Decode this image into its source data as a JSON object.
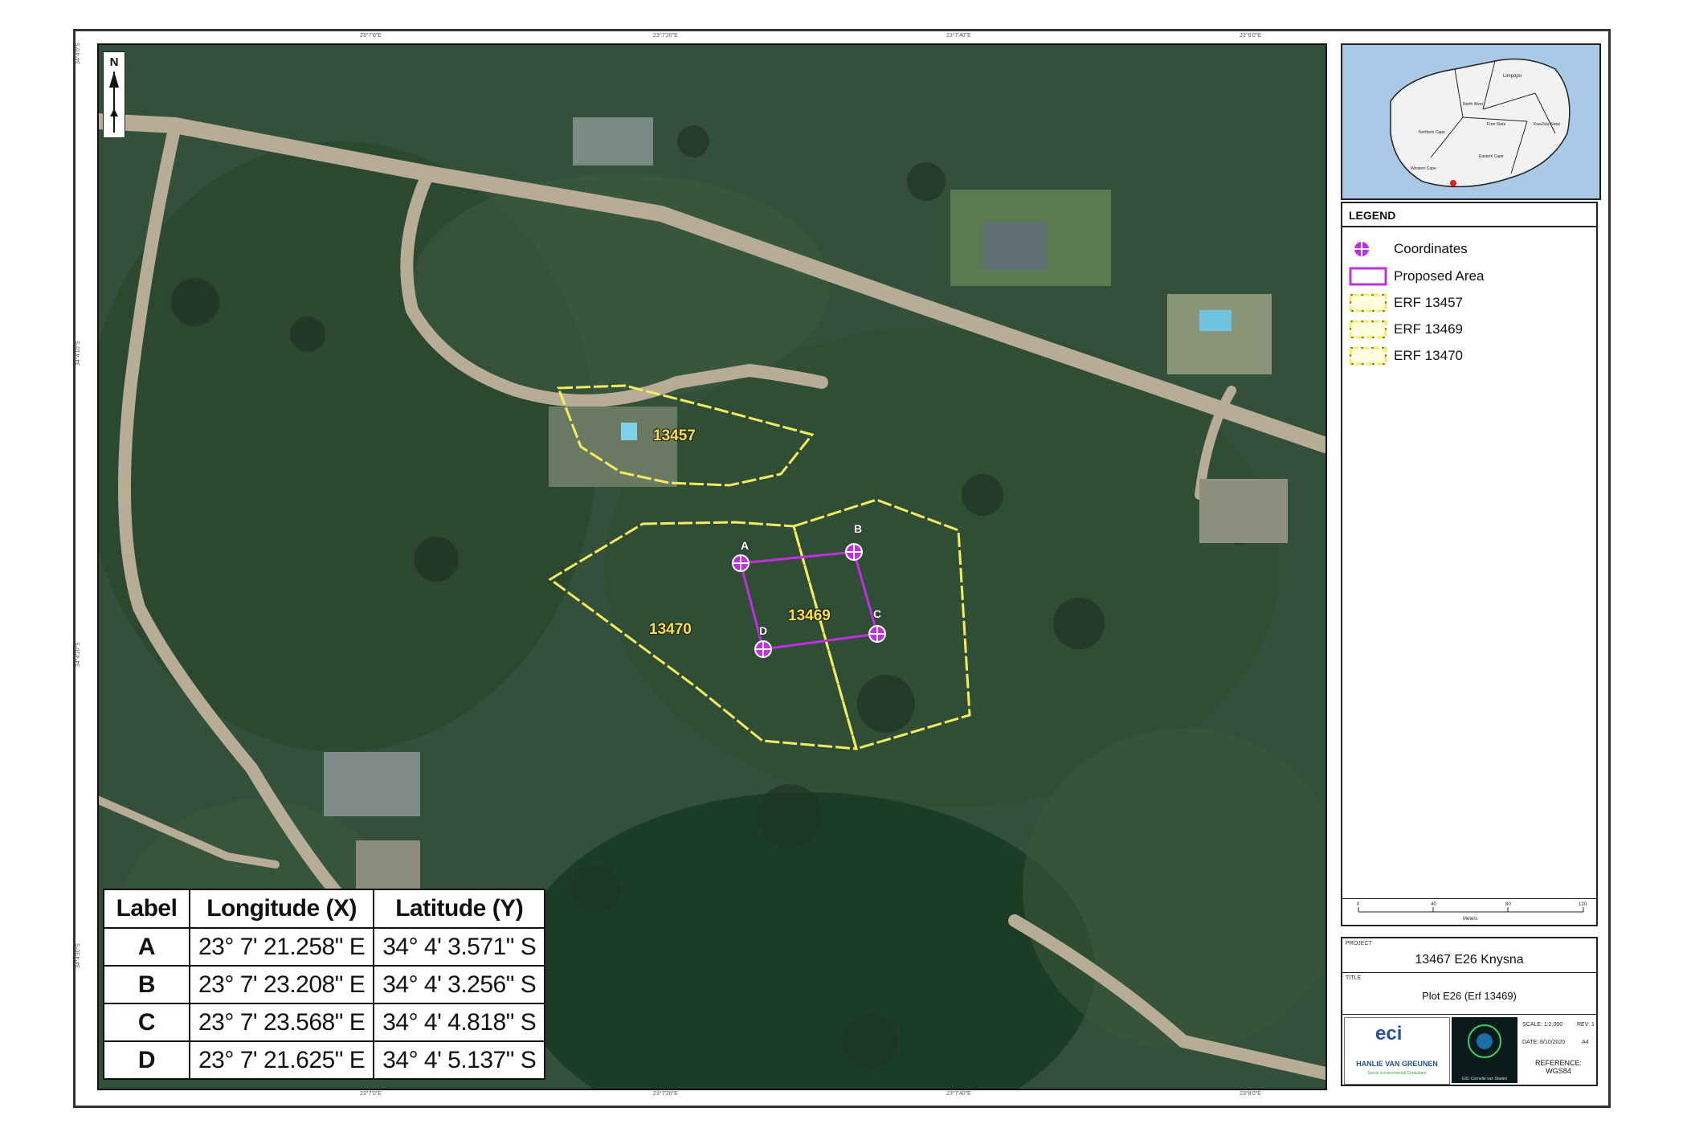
{
  "map": {
    "erf_labels": [
      "13457",
      "13469",
      "13470"
    ],
    "point_labels": [
      "A",
      "B",
      "C",
      "D"
    ],
    "north_label": "N",
    "ticks_top": [
      "23°7'0\"E",
      "23°7'20\"E",
      "23°7'40\"E",
      "23°8'0\"E"
    ],
    "ticks_bottom": [
      "23°7'0\"E",
      "23°7'20\"E",
      "23°7'40\"E",
      "23°8'0\"E"
    ],
    "ticks_left": [
      "34°4'0\"S",
      "34°4'10\"S",
      "34°4'20\"S",
      "34°4'30\"S"
    ]
  },
  "coords_table": {
    "headers": [
      "Label",
      "Longitude (X)",
      "Latitude (Y)"
    ],
    "rows": [
      {
        "label": "A",
        "lon": "23° 7' 21.258\" E",
        "lat": "34° 4' 3.571\" S"
      },
      {
        "label": "B",
        "lon": "23° 7' 23.208\" E",
        "lat": "34° 4' 3.256\" S"
      },
      {
        "label": "C",
        "lon": "23° 7' 23.568\" E",
        "lat": "34° 4' 4.818\" S"
      },
      {
        "label": "D",
        "lon": "23° 7' 21.625\" E",
        "lat": "34° 4' 5.137\" S"
      }
    ]
  },
  "inset": {
    "regions": [
      "Limpopo",
      "North West",
      "Free State",
      "Northern Cape",
      "Western Cape",
      "Eastern Cape",
      "KwaZulu-Natal"
    ],
    "marker_color": "#e0201c"
  },
  "legend": {
    "title": "LEGEND",
    "items": [
      {
        "label": "Coordinates",
        "icon": "coordinate-marker-icon",
        "color": "#c030e0"
      },
      {
        "label": "Proposed Area",
        "icon": "proposed-area-symbol",
        "color": "#c030e0"
      },
      {
        "label": "ERF 13457",
        "icon": "erf-boundary-symbol",
        "color": "#f4ec60"
      },
      {
        "label": "ERF 13469",
        "icon": "erf-boundary-symbol",
        "color": "#f4ec60"
      },
      {
        "label": "ERF 13470",
        "icon": "erf-boundary-symbol",
        "color": "#f4ec60"
      }
    ],
    "scale_ticks": [
      "0",
      "40",
      "80",
      "120"
    ],
    "scale_unit": "Meters"
  },
  "info": {
    "project_caption": "PROJECT",
    "project": "13467 E26 Knysna",
    "title_caption": "TITLE",
    "title": "Plot E26 (Erf 13469)",
    "company_brand": "eci",
    "company_name": "HANLIE VAN GREUNEN",
    "company_sub": "Senior Environmental Consultant",
    "partner_caption": "GIS: Cornelle van Staden",
    "scale_text": "SCALE: 1:2,000",
    "rev_text": "REV: 1",
    "date_text": "DATE: 8/10/2020",
    "size_text": "A4",
    "reference_caption": "REFERENCE:",
    "reference": "WGS84"
  },
  "colors": {
    "erf_boundary": "#f4ec60",
    "proposed_area": "#c030e0",
    "road": "#b7ad96",
    "vegetation_dark": "#213b23"
  }
}
